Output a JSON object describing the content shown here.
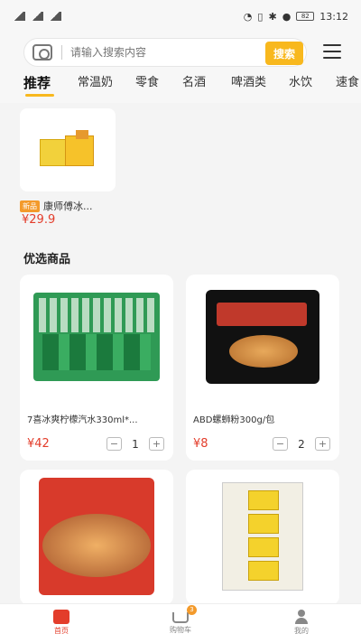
{
  "status_bar": {
    "left_icons": [
      "sim-icon",
      "signal-icon",
      "wifi-icon"
    ],
    "right_icons": [
      "alarm-icon",
      "vibrate-icon",
      "bluetooth-icon",
      "location-icon"
    ],
    "battery": "82",
    "time": "13:12"
  },
  "search": {
    "placeholder": "请输入搜索内容",
    "button_label": "搜索"
  },
  "tabs": [
    "推荐",
    "常温奶",
    "零食",
    "名酒",
    "啤酒类",
    "水饮",
    "速食"
  ],
  "active_tab": 0,
  "hot_item": {
    "badge": "新品",
    "title": "康师傅冰...",
    "price": "¥29.9"
  },
  "section_title": "优选商品",
  "products": [
    {
      "name": "7喜冰爽柠檬汽水330ml*...",
      "price": "¥42",
      "quantity": "1"
    },
    {
      "name": "ABD螺蛳粉300g/包",
      "price": "¥8",
      "quantity": "2"
    },
    {
      "name": "",
      "price": "",
      "quantity": ""
    },
    {
      "name": "",
      "price": "",
      "quantity": ""
    }
  ],
  "stepper": {
    "minus": "−",
    "plus": "+"
  },
  "nav": {
    "home": "首页",
    "cart": "购物车",
    "cart_badge": "3",
    "mine": "我的"
  },
  "colors": {
    "accent": "#f8b81e",
    "price": "#e33d2b",
    "badge": "#f39a2b"
  }
}
